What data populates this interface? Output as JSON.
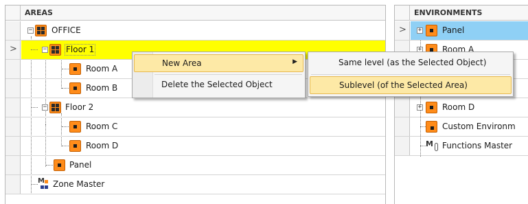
{
  "areas_tree": {
    "header": "AREAS",
    "nodes": [
      {
        "label": "OFFICE",
        "icon": "area-grid-icon",
        "expander": "-"
      },
      {
        "label": "Floor 1",
        "icon": "area-grid-icon",
        "expander": "-",
        "selected": true
      },
      {
        "label": "Room A",
        "icon": "room-icon"
      },
      {
        "label": "Room B",
        "icon": "room-icon"
      },
      {
        "label": "Floor 2",
        "icon": "area-grid-icon",
        "expander": "-"
      },
      {
        "label": "Room C",
        "icon": "room-icon"
      },
      {
        "label": "Room D",
        "icon": "room-icon"
      },
      {
        "label": "Panel",
        "icon": "room-icon"
      },
      {
        "label": "Zone Master",
        "icon": "zone-master-icon"
      }
    ],
    "current_row_marker": ">"
  },
  "environments_tree": {
    "header": "ENVIRONMENTS",
    "nodes": [
      {
        "label": "Panel",
        "icon": "room-icon",
        "expander": "+",
        "selected": true
      },
      {
        "label": "Room A",
        "icon": "room-icon",
        "expander": "+"
      },
      {
        "label": "Room D",
        "icon": "room-icon",
        "expander": "+"
      },
      {
        "label": "Custom Environm",
        "icon": "custom-environment-icon"
      },
      {
        "label": "Functions Master",
        "icon": "functions-master-icon"
      }
    ],
    "current_row_marker": ">"
  },
  "context_menu": {
    "items": [
      {
        "label": "New Area",
        "has_submenu": true,
        "highlighted": true
      },
      {
        "label": "Delete the Selected Object"
      }
    ],
    "submenu": {
      "items": [
        {
          "label": "Same level (as the Selected Object)"
        },
        {
          "label": "Sublevel (of the Selected Area)",
          "highlighted": true
        }
      ]
    }
  },
  "colors": {
    "selection_yellow": "#ffff00",
    "selection_blue": "#8fd0f5",
    "icon_orange": "#ff8c1a",
    "menu_highlight": "#fde9a6"
  }
}
